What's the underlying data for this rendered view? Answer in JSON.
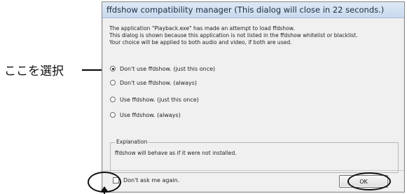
{
  "dialog": {
    "title": "ffdshow compatibility manager   (This dialog will close in 22 seconds.)",
    "message_lines": [
      "The application \"Playback.exe\" has made an attempt to load ffdshow.",
      "This dialog is shown because this application is not listed in the ffdshow whitelist or blacklist.",
      "Your choice will be applied to both audio and video, if both are used."
    ],
    "options": [
      {
        "label": "Don't use ffdshow. (just this once)",
        "selected": true
      },
      {
        "label": "Don't use ffdshow. (always)",
        "selected": false
      },
      {
        "label": "Use ffdshow. (just this once)",
        "selected": false
      },
      {
        "label": "Use ffdshow. (always)",
        "selected": false
      }
    ],
    "explanation": {
      "title": "Explanation",
      "text": "ffdshow will behave as if it were not installed."
    },
    "dont_ask_label": "Don't ask me again.",
    "ok_label": "OK"
  },
  "annotation": {
    "label": "ここを選択"
  }
}
